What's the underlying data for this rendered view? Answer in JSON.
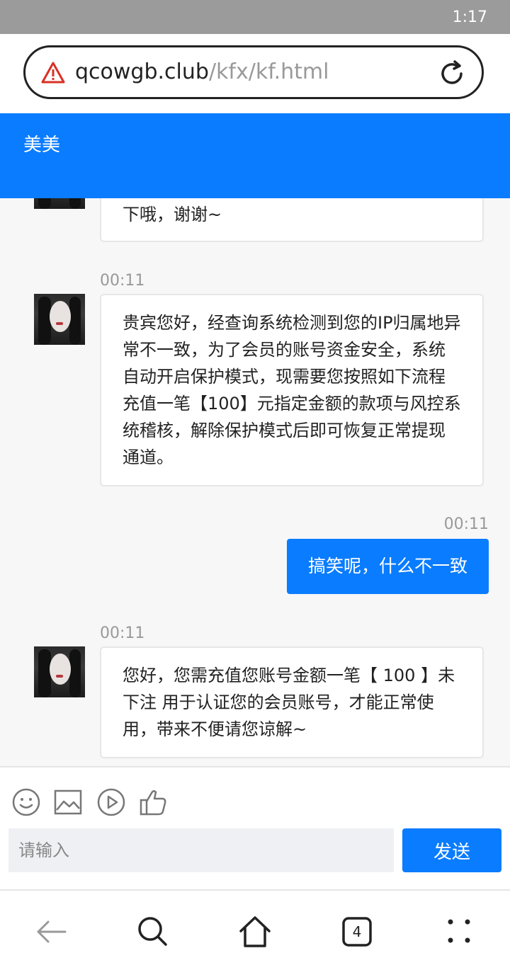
{
  "status_bar": {
    "time": "1:17"
  },
  "browser": {
    "url_host": "qcowgb.club",
    "url_path": "/kfx/kf.html",
    "tabs_count": "4"
  },
  "chat": {
    "contact_name": "美美",
    "messages": [
      {
        "from": "agent",
        "time": "",
        "text": "下哦，谢谢~"
      },
      {
        "from": "agent",
        "time": "00:11",
        "text": "贵宾您好，经查询系统检测到您的IP归属地异常不一致，为了会员的账号资金安全，系统自动开启保护模式，现需要您按照如下流程充值一笔【100】元指定金额的款项与风控系统稽核，解除保护模式后即可恢复正常提现通道。"
      },
      {
        "from": "user",
        "time": "00:11",
        "text": "搞笑呢，什么不一致"
      },
      {
        "from": "agent",
        "time": "00:11",
        "text": "您好，您需充值您账号金额一笔【 100 】未下注 用于认证您的会员账号，才能正常使用，带来不便请您谅解~"
      }
    ]
  },
  "composer": {
    "placeholder": "请输入",
    "send_label": "发送"
  },
  "icons": {
    "toolbar": [
      "emoji-icon",
      "image-icon",
      "video-icon",
      "thumbs-up-icon"
    ],
    "nav": [
      "back-icon",
      "search-icon",
      "home-icon",
      "tabs-icon",
      "menu-icon"
    ]
  },
  "colors": {
    "accent": "#0a7cff",
    "warning": "#d93025"
  }
}
